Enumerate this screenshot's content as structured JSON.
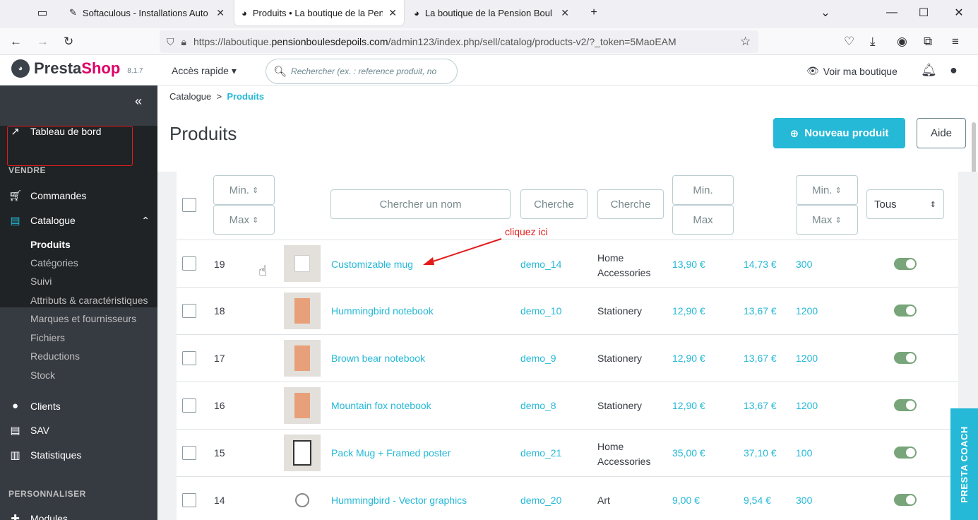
{
  "browser": {
    "tabs": [
      {
        "label": "Softaculous - Installations Auto",
        "active": false
      },
      {
        "label": "Produits • La boutique de la Pen",
        "active": true
      },
      {
        "label": "La boutique de la Pension Boul",
        "active": false
      }
    ],
    "url_prefix": "https://laboutique.",
    "url_domain": "pensionboulesdepoils.com",
    "url_path": "/admin123/index.php/sell/catalog/products-v2/?_token=5MaoEAM"
  },
  "header": {
    "logo_text_1": "Presta",
    "logo_text_2": "Shop",
    "version": "8.1.7",
    "quick_access": "Accès rapide",
    "search_placeholder": "Rechercher (ex. : reference produit, no",
    "view_shop": "Voir ma boutique"
  },
  "sidebar": {
    "dashboard": "Tableau de bord",
    "section_sell": "VENDRE",
    "orders": "Commandes",
    "catalog": "Catalogue",
    "catalog_sub": [
      "Produits",
      "Catégories",
      "Suivi",
      "Attributs & caractéristiques",
      "Marques et fournisseurs",
      "Fichiers",
      "Reductions",
      "Stock"
    ],
    "clients": "Clients",
    "sav": "SAV",
    "stats": "Statistiques",
    "section_custom": "PERSONNALISER",
    "modules": "Modules"
  },
  "page": {
    "breadcrumb_parent": "Catalogue",
    "breadcrumb_current": "Produits",
    "title": "Produits",
    "new_product": "Nouveau produit",
    "help": "Aide"
  },
  "filters": {
    "min": "Min.",
    "max": "Max",
    "name_placeholder": "Chercher un nom",
    "ref_placeholder": "Cherche",
    "cat_placeholder": "Cherche",
    "status_select": "Tous"
  },
  "annotation": "cliquez ici",
  "products": [
    {
      "id": "19",
      "name": "Customizable mug",
      "ref": "demo_14",
      "category": [
        "Home",
        "Accessories"
      ],
      "price": "13,90 €",
      "price_ttc": "14,73 €",
      "qty": "300"
    },
    {
      "id": "18",
      "name": "Hummingbird notebook",
      "ref": "demo_10",
      "category": [
        "Stationery"
      ],
      "price": "12,90 €",
      "price_ttc": "13,67 €",
      "qty": "1200"
    },
    {
      "id": "17",
      "name": "Brown bear notebook",
      "ref": "demo_9",
      "category": [
        "Stationery"
      ],
      "price": "12,90 €",
      "price_ttc": "13,67 €",
      "qty": "1200"
    },
    {
      "id": "16",
      "name": "Mountain fox notebook",
      "ref": "demo_8",
      "category": [
        "Stationery"
      ],
      "price": "12,90 €",
      "price_ttc": "13,67 €",
      "qty": "1200"
    },
    {
      "id": "15",
      "name": "Pack Mug + Framed poster",
      "ref": "demo_21",
      "category": [
        "Home",
        "Accessories"
      ],
      "price": "35,00 €",
      "price_ttc": "37,10 €",
      "qty": "100"
    },
    {
      "id": "14",
      "name": "Hummingbird - Vector graphics",
      "ref": "demo_20",
      "category": [
        "Art"
      ],
      "price": "9,00 €",
      "price_ttc": "9,54 €",
      "qty": "300"
    }
  ],
  "coach": "PRESTA COACH"
}
